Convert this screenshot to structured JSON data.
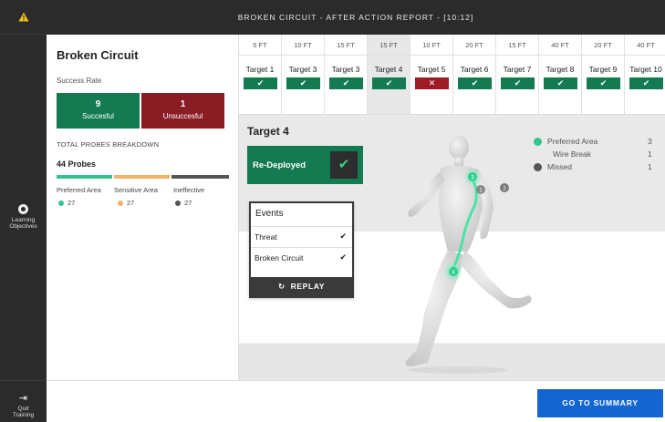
{
  "header": {
    "title": "BROKEN CIRCUIT - AFTER ACTION REPORT - [10:12]"
  },
  "rail": {
    "logo_icon": "warning-triangle-icon",
    "learning_objectives_line1": "Learning",
    "learning_objectives_line2": "Objectives",
    "quit_line1": "Quit",
    "quit_line2": "Training"
  },
  "summary": {
    "title": "Broken Circuit",
    "success_rate_label": "Success Rate",
    "successful_count": "9",
    "successful_label": "Succesful",
    "unsuccessful_count": "1",
    "unsuccessful_label": "Unsuccesful",
    "probes_breakdown_label": "TOTAL PROBES BREAKDOWN",
    "probes_total": "44 Probes",
    "categories": [
      {
        "label": "Preferred Area",
        "count": "27",
        "color": "#33c48e"
      },
      {
        "label": "Sensitive Area",
        "count": "27",
        "color": "#f2b46a"
      },
      {
        "label": "Ineffective",
        "count": "27",
        "color": "#555555"
      }
    ]
  },
  "targets": [
    {
      "distance": "5 FT",
      "name": "Target 1",
      "status": "success",
      "mark": "✔"
    },
    {
      "distance": "10 FT",
      "name": "Target 3",
      "status": "success",
      "mark": "✔"
    },
    {
      "distance": "15 FT",
      "name": "Target 3",
      "status": "success",
      "mark": "✔"
    },
    {
      "distance": "15 FT",
      "name": "Target 4",
      "status": "success",
      "mark": "✔",
      "selected": true
    },
    {
      "distance": "10 FT",
      "name": "Target 5",
      "status": "failure",
      "mark": "✕"
    },
    {
      "distance": "20 FT",
      "name": "Target 6",
      "status": "success",
      "mark": "✔"
    },
    {
      "distance": "15 FT",
      "name": "Target 7",
      "status": "success",
      "mark": "✔"
    },
    {
      "distance": "40 FT",
      "name": "Target 8",
      "status": "success",
      "mark": "✔"
    },
    {
      "distance": "20 FT",
      "name": "Target 9",
      "status": "success",
      "mark": "✔"
    },
    {
      "distance": "40 FT",
      "name": "Target 10",
      "status": "success",
      "mark": "✔"
    }
  ],
  "detail": {
    "title": "Target 4",
    "status_label": "Re-Deployed",
    "status_mark": "✔",
    "legend": [
      {
        "label": "Preferred Area",
        "value": "3",
        "color": "#33c48e"
      },
      {
        "label": "Wire Break",
        "value": "1",
        "color": ""
      },
      {
        "label": "Missed",
        "value": "1",
        "color": "#555555"
      }
    ],
    "events_title": "Events",
    "events": [
      {
        "label": "Threat",
        "mark": "✔"
      },
      {
        "label": "Broken Circuit",
        "mark": "✔"
      }
    ],
    "replay_icon": "replay-icon",
    "replay_label": "REPLAY",
    "probe_markers": [
      {
        "label": "3",
        "kind": "preferred"
      },
      {
        "label": "1",
        "kind": "missed"
      },
      {
        "label": "2",
        "kind": "missed"
      },
      {
        "label": "4",
        "kind": "preferred"
      }
    ]
  },
  "footer": {
    "summary_button": "GO TO SUMMARY"
  }
}
